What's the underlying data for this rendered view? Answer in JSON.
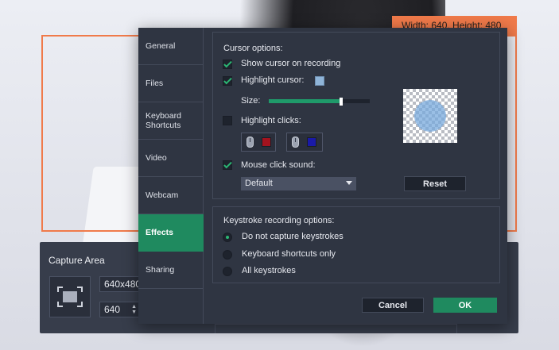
{
  "overlay": {
    "dimensions_label": "Width: 640, Height: 480"
  },
  "capture_panel": {
    "title": "Capture Area",
    "size_value": "640x480",
    "width_value": "640"
  },
  "dialog": {
    "nav": [
      {
        "label": "General"
      },
      {
        "label": "Files"
      },
      {
        "label": "Keyboard Shortcuts"
      },
      {
        "label": "Video"
      },
      {
        "label": "Webcam"
      },
      {
        "label": "Effects"
      },
      {
        "label": "Sharing"
      }
    ],
    "active_nav": "Effects",
    "cursor": {
      "title": "Cursor options:",
      "show_cursor_label": "Show cursor on recording",
      "show_cursor_checked": true,
      "highlight_cursor_label": "Highlight cursor:",
      "highlight_cursor_checked": true,
      "highlight_color": "#8fb4d8",
      "size_label": "Size:",
      "size_level_fraction": 0.72,
      "highlight_clicks_label": "Highlight clicks:",
      "highlight_clicks_checked": false,
      "left_click_color": "#a3131e",
      "right_click_color": "#1a1aa8",
      "mouse_sound_label": "Mouse click sound:",
      "mouse_sound_checked": true,
      "sound_selected": "Default",
      "reset_label": "Reset"
    },
    "keystrokes": {
      "title": "Keystroke recording options:",
      "options": [
        {
          "label": "Do not capture keystrokes",
          "selected": true
        },
        {
          "label": "Keyboard shortcuts only",
          "selected": false
        },
        {
          "label": "All keystrokes",
          "selected": false
        }
      ]
    },
    "buttons": {
      "cancel": "Cancel",
      "ok": "OK"
    },
    "colors": {
      "accent": "#1f8a5f",
      "check": "#2bb673",
      "frame": "#f07a4a"
    }
  }
}
